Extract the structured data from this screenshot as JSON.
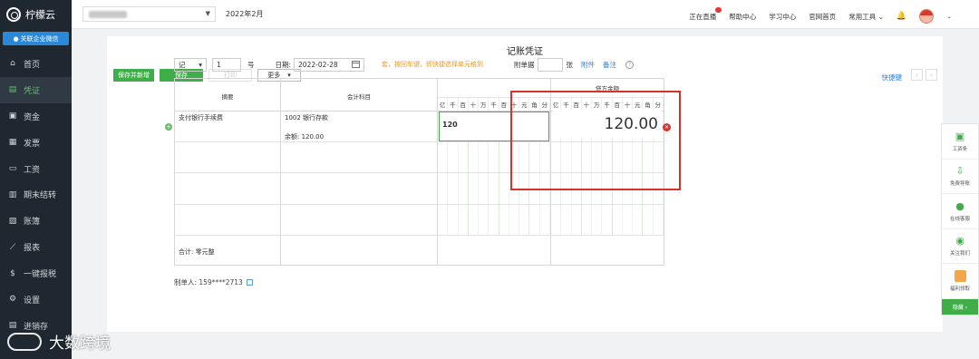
{
  "app": {
    "name": "柠檬云",
    "follow_btn": "关联企业微信"
  },
  "sidebar": {
    "items": [
      {
        "label": "首页",
        "icon": "home-icon"
      },
      {
        "label": "凭证",
        "icon": "voucher-icon",
        "active": true
      },
      {
        "label": "资金",
        "icon": "fund-icon"
      },
      {
        "label": "发票",
        "icon": "invoice-icon"
      },
      {
        "label": "工资",
        "icon": "salary-icon"
      },
      {
        "label": "期末结转",
        "icon": "period-close-icon"
      },
      {
        "label": "账簿",
        "icon": "ledger-icon"
      },
      {
        "label": "报表",
        "icon": "report-icon"
      },
      {
        "label": "一键报税",
        "icon": "tax-icon"
      },
      {
        "label": "设置",
        "icon": "settings-icon"
      },
      {
        "label": "进销存",
        "icon": "inventory-icon"
      }
    ]
  },
  "topbar": {
    "period": "2022年2月",
    "links": [
      "正在直播",
      "帮助中心",
      "学习中心",
      "官网首页"
    ],
    "tools": "常用工具"
  },
  "page": {
    "title": "记账凭证",
    "buttons": {
      "save_new": "保存并新增",
      "save": "保存",
      "disabled": "打印",
      "more": "更多"
    },
    "shortcut": "快捷键"
  },
  "voucher": {
    "word": "记",
    "number": "1",
    "hao": "号",
    "date_label": "日期:",
    "date": "2022-02-28",
    "hint": "套，按回车键，即快捷选择单元格到",
    "attach_label": "附单据",
    "zhang": "张",
    "attachment_link": "附件",
    "note_link": "备注",
    "headers": {
      "summary": "摘要",
      "subject": "会计科目",
      "credit": "贷方金额"
    },
    "units": [
      "亿",
      "千",
      "百",
      "十",
      "万",
      "千",
      "百",
      "十",
      "元",
      "角",
      "分"
    ],
    "rows": [
      {
        "summary": "支付银行手续费",
        "subject": "1002 银行存款",
        "balance": "余额: 120.00",
        "debit": "120"
      }
    ],
    "total": "合计: 零元整",
    "maker": "制单人: 159****2713"
  },
  "callout": {
    "value": "120.00"
  },
  "float_panel": {
    "items": [
      "工资条",
      "免费导账",
      "在线客服",
      "关注我们",
      "福利领取"
    ],
    "collapse": "隐藏 ›"
  },
  "watermark": "大数跨境",
  "colors": {
    "accent": "#3fae49",
    "sidebar_bg": "#1f2830",
    "highlight": "#d9312a",
    "link": "#2b7cd8"
  }
}
